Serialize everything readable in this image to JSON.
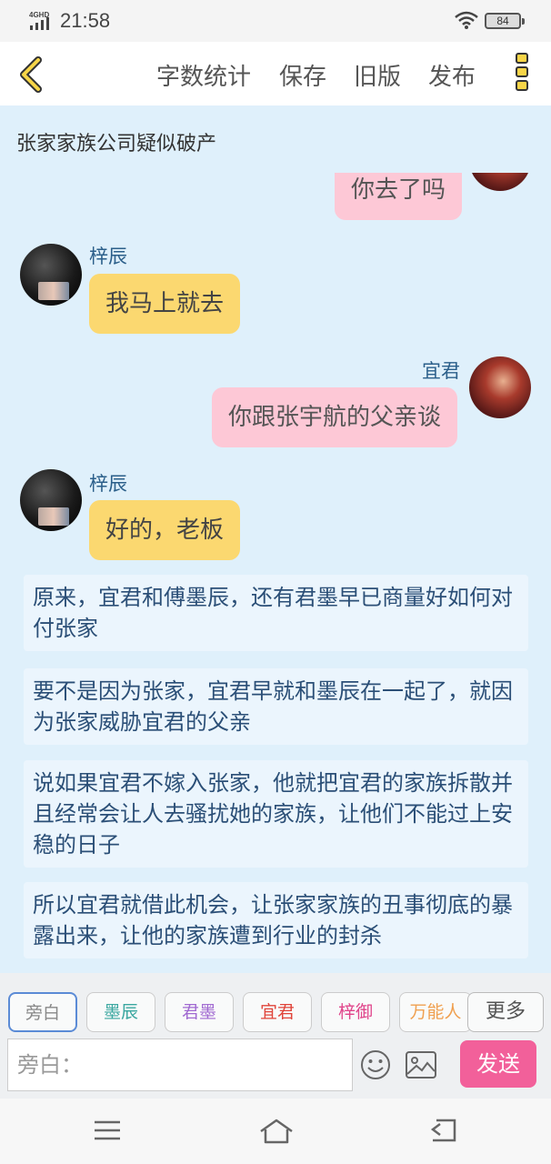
{
  "status": {
    "time": "21:58",
    "network": "4GHD",
    "battery": "84"
  },
  "toolbar": {
    "word_count": "字数统计",
    "save": "保存",
    "old_version": "旧版",
    "publish": "发布"
  },
  "story": {
    "title": "张家家族公司疑似破产"
  },
  "messages": [
    {
      "type": "bubble",
      "side": "right",
      "text": "你去了吗",
      "color": "#fdc8d6"
    },
    {
      "type": "bubble",
      "side": "left",
      "name": "梓辰",
      "text": "我马上就去",
      "color": "#fbd870"
    },
    {
      "type": "bubble",
      "side": "right",
      "name": "宜君",
      "text": "你跟张宇航的父亲谈",
      "color": "#fdc8d6"
    },
    {
      "type": "bubble",
      "side": "left",
      "name": "梓辰",
      "text": "好的，老板",
      "color": "#fbd870"
    },
    {
      "type": "narration",
      "text": "原来，宜君和傅墨辰，还有君墨早已商量好如何对付张家"
    },
    {
      "type": "narration",
      "text": "要不是因为张家，宜君早就和墨辰在一起了，就因为张家威胁宜君的父亲"
    },
    {
      "type": "narration",
      "text": "说如果宜君不嫁入张家，他就把宜君的家族拆散并且经常会让人去骚扰她的家族，让他们不能过上安稳的日子"
    },
    {
      "type": "narration",
      "text": "所以宜君就借此机会，让张家家族的丑事彻底的暴露出来，让他的家族遭到行业的封杀"
    }
  ],
  "roles": [
    {
      "label": "旁白",
      "color": "#888888",
      "active": true
    },
    {
      "label": "墨辰",
      "color": "#3aa7a0"
    },
    {
      "label": "君墨",
      "color": "#a16ad1"
    },
    {
      "label": "宜君",
      "color": "#e0443a"
    },
    {
      "label": "梓御",
      "color": "#e0448a"
    },
    {
      "label": "万能人",
      "color": "#f0a050"
    }
  ],
  "more": "更多",
  "input": {
    "placeholder": "旁白："
  },
  "send": "发送",
  "icons": {
    "back": "chevron-left-icon",
    "menu": "more-vertical-icon",
    "emoji": "smile-icon",
    "image": "image-icon",
    "nav": [
      "menu-icon",
      "home-icon",
      "back-icon"
    ]
  }
}
